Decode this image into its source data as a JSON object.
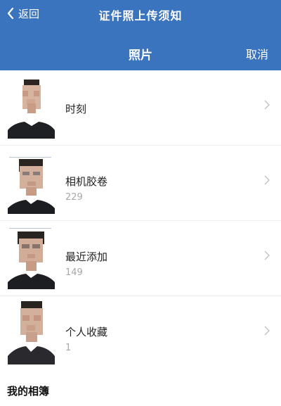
{
  "nav": {
    "back_label": "返回",
    "title": "证件照上传须知"
  },
  "subnav": {
    "title": "照片",
    "cancel_label": "取消"
  },
  "albums": [
    {
      "label": "时刻",
      "count": ""
    },
    {
      "label": "相机胶卷",
      "count": "229"
    },
    {
      "label": "最近添加",
      "count": "149"
    },
    {
      "label": "个人收藏",
      "count": "1"
    }
  ],
  "section_title": "我的相簿",
  "colors": {
    "header_bg": "#3a73be",
    "header_text": "#ffffff",
    "count_text": "#a8a8a8"
  }
}
